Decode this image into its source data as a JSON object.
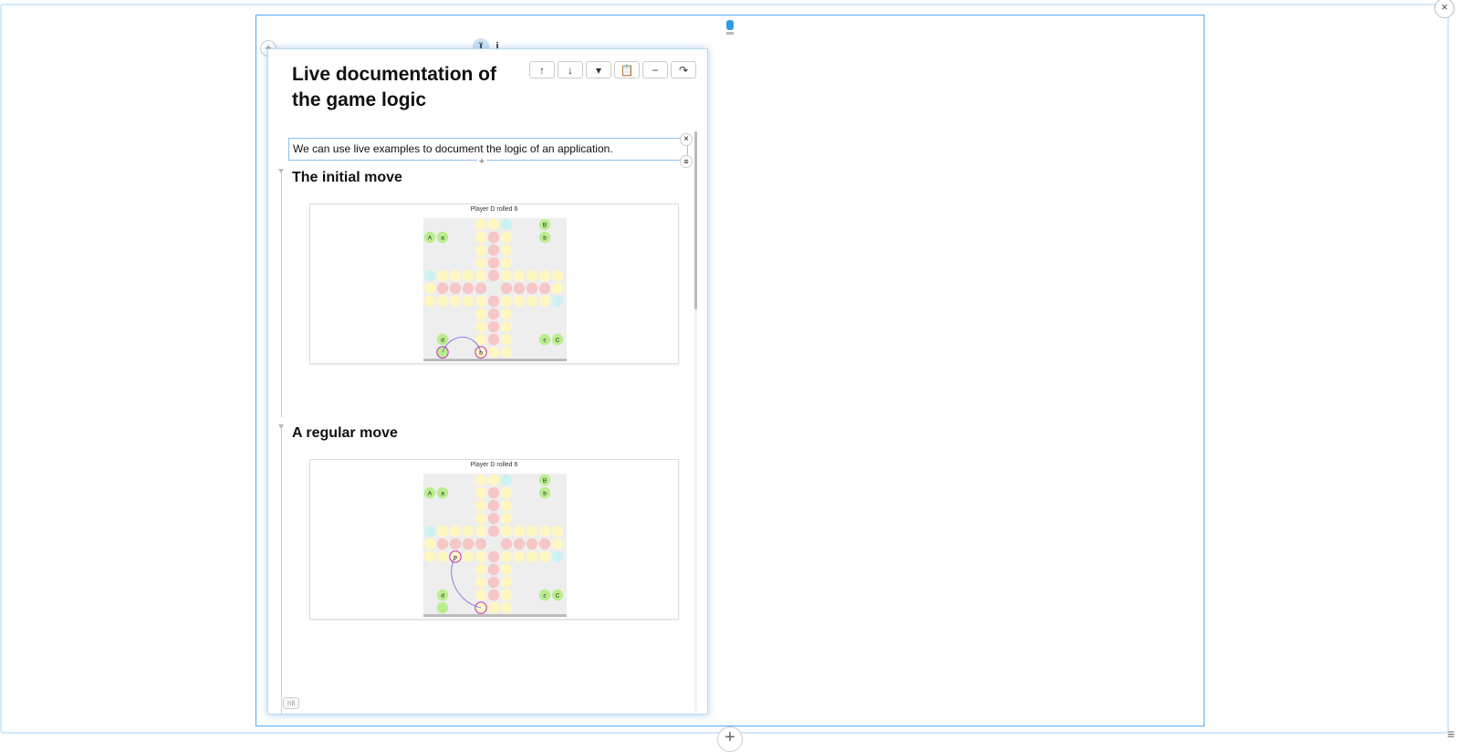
{
  "page": {
    "add_label": "+",
    "close_label": "×",
    "info_labels": [
      "ї",
      "i"
    ],
    "bottom_add": "+",
    "bottom_menu": "≡"
  },
  "cell": {
    "title": "Live documentation of the game logic",
    "toolbar": [
      "↑",
      "↓",
      "▾",
      "📋",
      "−",
      "↷"
    ],
    "intro_text": "We can use live examples to document the logic of an application.",
    "intro_close": "×",
    "intro_add": "+",
    "intro_menu": "≡",
    "nil_label": "nil"
  },
  "sections": [
    {
      "title": "The initial move",
      "caption": "Player D rolled 6",
      "home_labels": [
        "A",
        "a",
        "B",
        "b",
        "c",
        "C",
        "d",
        "b"
      ]
    },
    {
      "title": "A regular move",
      "caption": "Player D rolled 6",
      "home_labels": [
        "A",
        "a",
        "B",
        "b",
        "c",
        "C",
        "d",
        "p"
      ]
    }
  ],
  "colors": {
    "accent": "#2f9be8",
    "track": "#fff7c2",
    "safe": "#f7c6c6",
    "start": "#cdf2f2",
    "home": "#b9ee8e",
    "path": "#6a64d8",
    "highlight": "#c62fbf"
  }
}
